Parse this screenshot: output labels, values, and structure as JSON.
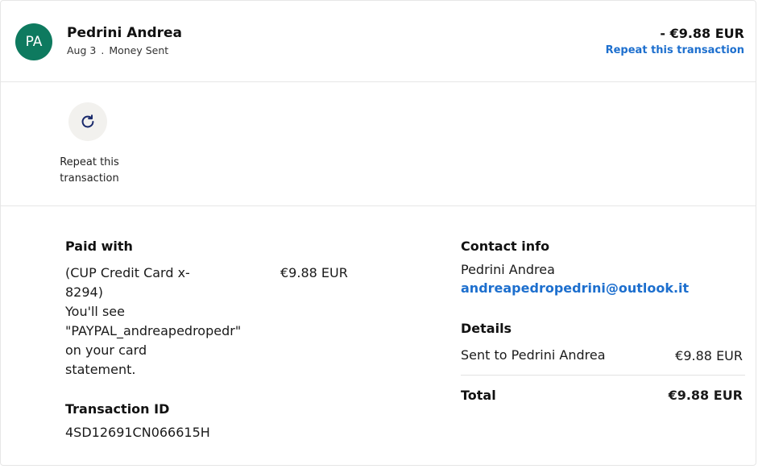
{
  "header": {
    "avatar_initials": "PA",
    "avatar_color": "#0e7a5f",
    "name": "Pedrini Andrea",
    "date": "Aug 3",
    "separator": ".",
    "type": "Money Sent",
    "amount": "- €9.88 EUR",
    "repeat_link": "Repeat this transaction",
    "link_color": "#1d6fce"
  },
  "actions": {
    "repeat_icon": "refresh-icon",
    "repeat_caption_line1": "Repeat this",
    "repeat_caption_line2": "transaction"
  },
  "paid_with": {
    "heading": "Paid with",
    "card_line1": "(CUP Credit Card x-",
    "card_line2": "8294)",
    "note_line1": "You'll see",
    "note_line2": "\"PAYPAL_andreapedropedr\"",
    "note_line3": "on your card",
    "note_line4": "statement.",
    "amount": "€9.88 EUR"
  },
  "transaction": {
    "heading": "Transaction ID",
    "id": "4SD12691CN066615H"
  },
  "contact": {
    "heading": "Contact info",
    "name": "Pedrini Andrea",
    "email": "andreapedropedrini@outlook.it"
  },
  "details": {
    "heading": "Details",
    "sent_to_label": "Sent to Pedrini Andrea",
    "sent_to_amount": "€9.88 EUR",
    "total_label": "Total",
    "total_amount": "€9.88 EUR"
  }
}
